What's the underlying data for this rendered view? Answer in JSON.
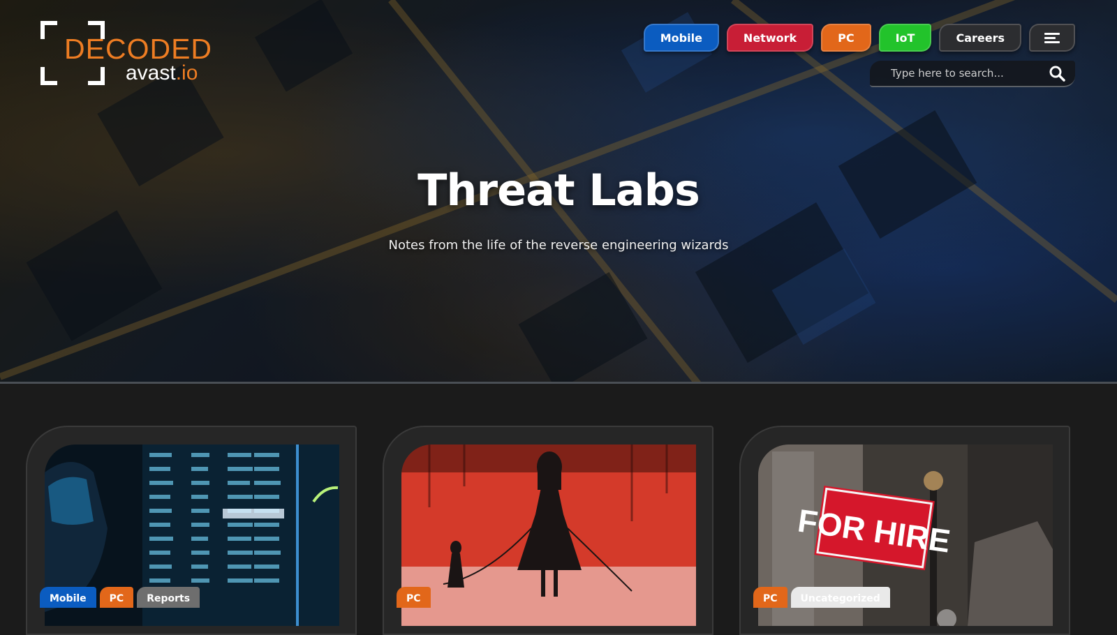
{
  "logo": {
    "line1": "DECODED",
    "line2": "avast",
    "line2_suffix": ".io",
    "accent": "#ee7d23"
  },
  "nav": [
    {
      "label": "Mobile",
      "color": "#0b5cc0"
    },
    {
      "label": "Network",
      "color": "#c81e36"
    },
    {
      "label": "PC",
      "color": "#e2671a"
    },
    {
      "label": "IoT",
      "color": "#22c32b"
    },
    {
      "label": "Careers",
      "color": "#2c2d30"
    }
  ],
  "menu": {
    "icon": "hamburger-icon"
  },
  "search": {
    "placeholder": "Type here to search...",
    "icon": "search-icon"
  },
  "hero": {
    "title": "Threat Labs",
    "subtitle": "Notes from the life of the reverse engineering wizards"
  },
  "cards": [
    {
      "tags": [
        {
          "label": "Mobile",
          "color": "#0b5cc0"
        },
        {
          "label": "PC",
          "color": "#e2671a"
        },
        {
          "label": "Reports",
          "color": "#6e6e6e"
        }
      ]
    },
    {
      "tags": [
        {
          "label": "PC",
          "color": "#e2671a"
        }
      ]
    },
    {
      "tags": [
        {
          "label": "PC",
          "color": "#e2671a"
        },
        {
          "label": "Uncategorized",
          "color": "#e9e9e9"
        }
      ],
      "sign_text": "FOR HIRE"
    }
  ]
}
